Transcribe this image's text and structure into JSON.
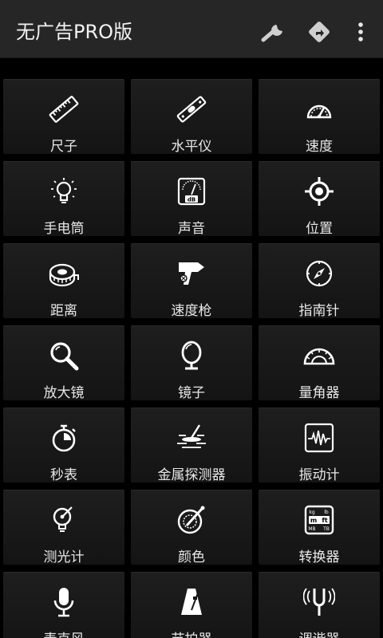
{
  "appbar": {
    "title": "无广告PRO版",
    "actions": [
      {
        "icon": "wrench-icon"
      },
      {
        "icon": "directions-icon"
      },
      {
        "icon": "more-vert-icon"
      }
    ]
  },
  "tools": [
    {
      "label": "尺子",
      "icon": "ruler-icon"
    },
    {
      "label": "水平仪",
      "icon": "level-icon"
    },
    {
      "label": "速度",
      "icon": "speedometer-icon"
    },
    {
      "label": "手电筒",
      "icon": "bulb-icon"
    },
    {
      "label": "声音",
      "icon": "decibel-meter-icon"
    },
    {
      "label": "位置",
      "icon": "location-target-icon"
    },
    {
      "label": "距离",
      "icon": "tape-measure-icon"
    },
    {
      "label": "速度枪",
      "icon": "speed-gun-icon"
    },
    {
      "label": "指南针",
      "icon": "compass-icon"
    },
    {
      "label": "放大镜",
      "icon": "magnifier-icon"
    },
    {
      "label": "镜子",
      "icon": "mirror-icon"
    },
    {
      "label": "量角器",
      "icon": "protractor-icon"
    },
    {
      "label": "秒表",
      "icon": "stopwatch-icon"
    },
    {
      "label": "金属探测器",
      "icon": "metal-detector-icon"
    },
    {
      "label": "振动计",
      "icon": "vibration-meter-icon"
    },
    {
      "label": "测光计",
      "icon": "light-meter-icon"
    },
    {
      "label": "颜色",
      "icon": "color-picker-icon"
    },
    {
      "label": "转换器",
      "icon": "unit-converter-icon"
    },
    {
      "label": "麦克风",
      "icon": "microphone-icon"
    },
    {
      "label": "节拍器",
      "icon": "metronome-icon"
    },
    {
      "label": "调谐器",
      "icon": "tuning-fork-icon"
    }
  ],
  "converter_icon_text": {
    "a": "kg",
    "b": "lb",
    "c": "m",
    "d": "ft",
    "e": "MB",
    "f": "TB"
  },
  "sound_icon_text": "dB"
}
